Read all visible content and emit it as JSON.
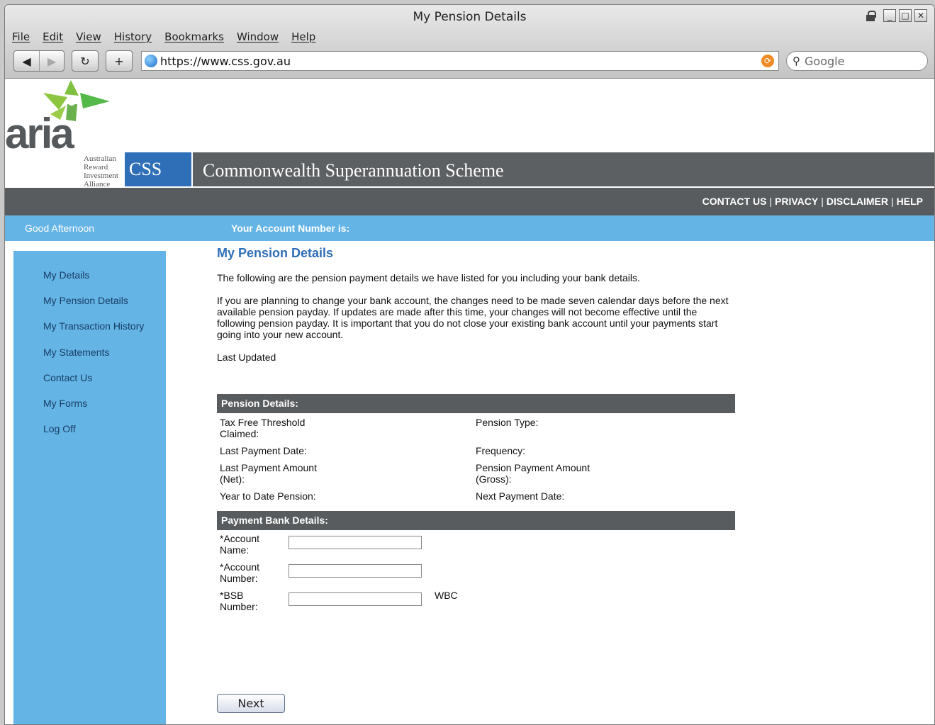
{
  "window": {
    "title": "My Pension Details",
    "minimize": "_",
    "maximize": "□",
    "close": "✕"
  },
  "menu": [
    "File",
    "Edit",
    "View",
    "History",
    "Bookmarks",
    "Window",
    "Help"
  ],
  "toolbar": {
    "back": "◀",
    "forward": "▶",
    "reload": "↻",
    "add": "+",
    "url": "https://www.css.gov.au",
    "search_placeholder": "Google"
  },
  "brand": {
    "logo_word": "aria",
    "logo_sub": [
      "Australian",
      "Reward",
      "Investment",
      "Alliance"
    ],
    "css": "CSS",
    "scheme": "Commonwealth Superannuation Scheme"
  },
  "topnav": [
    "CONTACT US",
    "PRIVACY",
    "DISCLAIMER",
    "HELP"
  ],
  "greeting": "Good Afternoon",
  "account_label": "Your Account Number is:",
  "sidebar": [
    "My Details",
    "My Pension Details",
    "My Transaction History",
    "My Statements",
    "Contact Us",
    "My Forms",
    "Log Off"
  ],
  "main": {
    "heading": "My Pension Details",
    "intro": "The following are the pension payment details we have listed for you including your bank details.",
    "notice": "If you are planning to change your bank account, the changes need to be made seven calendar days before the next available pension payday. If updates are made after this time, your changes will not become effective until the following pension payday. It is important that you do not close your existing bank account until your payments start going into your new account.",
    "last_updated": "Last Updated"
  },
  "pension": {
    "heading": "Pension Details:",
    "tax_free": "Tax Free Threshold Claimed:",
    "pension_type": "Pension Type:",
    "last_payment_date": "Last Payment Date:",
    "frequency": "Frequency:",
    "last_payment_amount": "Last Payment Amount (Net):",
    "pension_payment_amount": "Pension Payment Amount (Gross):",
    "ytd": "Year to Date Pension:",
    "next_payment_date": "Next Payment Date:"
  },
  "bank": {
    "heading": "Payment Bank Details:",
    "account_name": "*Account Name:",
    "account_number": "*Account Number:",
    "bsb": "*BSB Number:",
    "bsb_bank": "WBC"
  },
  "next_label": "Next"
}
